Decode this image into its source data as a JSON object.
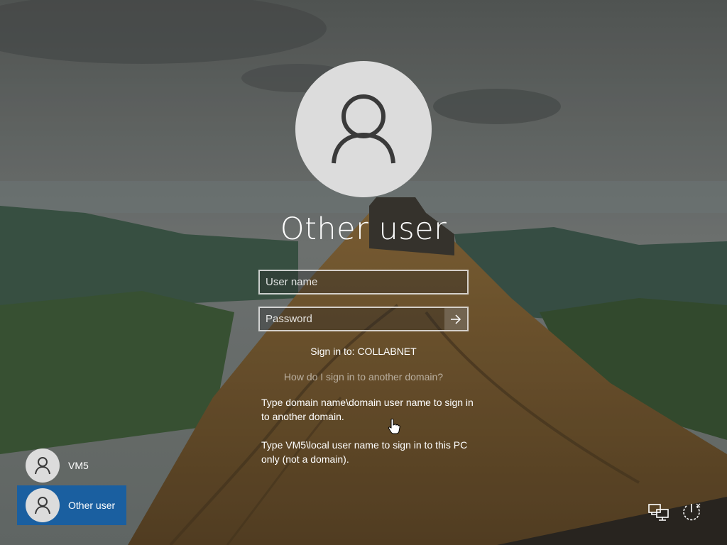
{
  "login": {
    "title": "Other user",
    "username_placeholder": "User name",
    "password_placeholder": "Password",
    "signin_to": "Sign in to: COLLABNET",
    "help_link": "How do I sign in to another domain?",
    "help_text_1": "Type domain name\\domain user name to sign in to another domain.",
    "help_text_2": "Type VM5\\local user name to sign in to this PC only (not a domain)."
  },
  "users": [
    {
      "name": "VM5",
      "selected": false
    },
    {
      "name": "Other user",
      "selected": true
    }
  ],
  "icons": {
    "avatar": "user-icon",
    "submit": "arrow-right-icon",
    "network": "network-icon",
    "power": "power-icon"
  },
  "colors": {
    "selected_tile": "#1a5fa0",
    "avatar_bg": "#dcdcdc"
  }
}
